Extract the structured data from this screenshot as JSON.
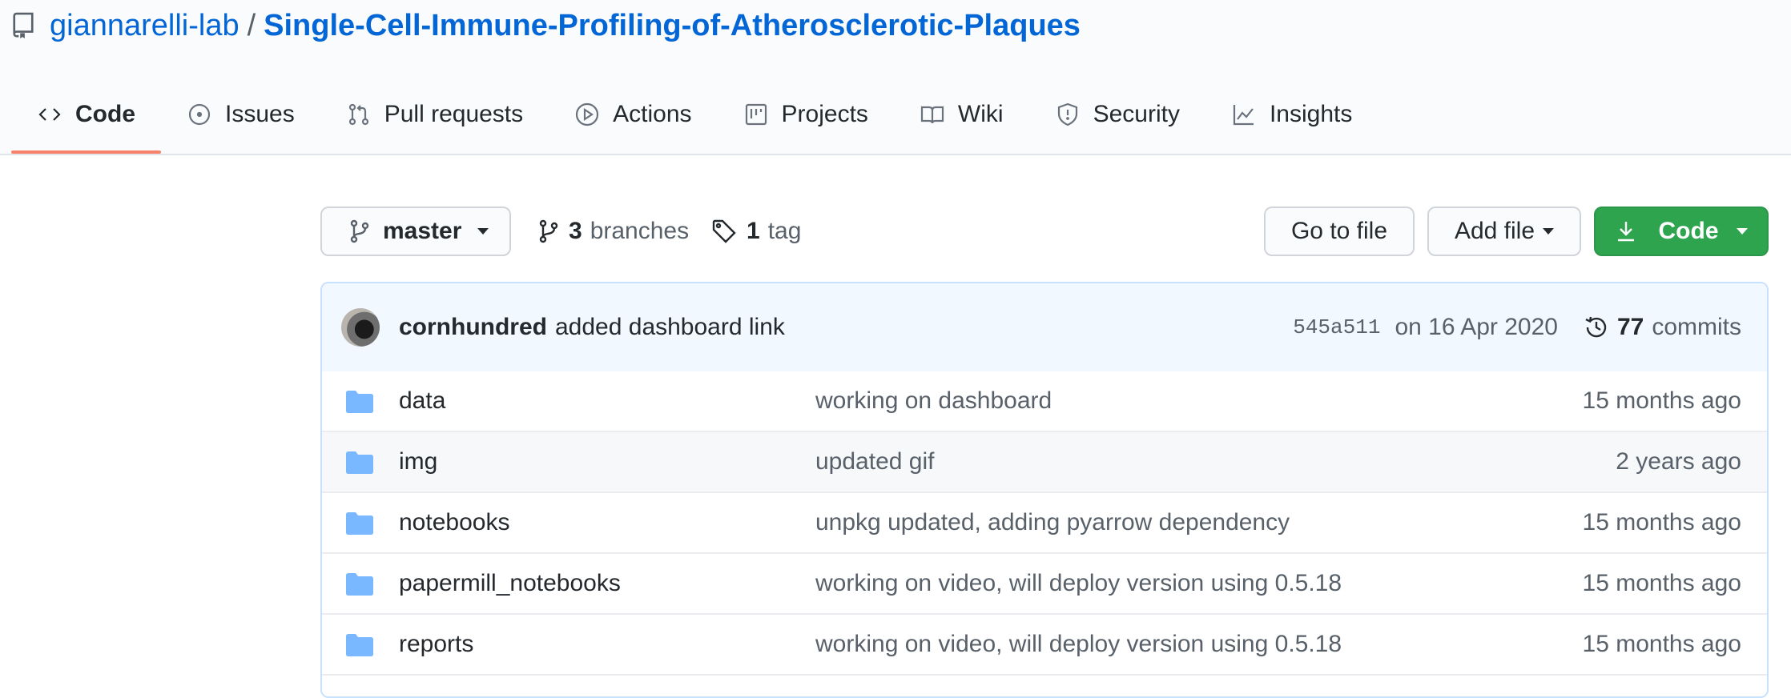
{
  "repo": {
    "owner": "giannarelli-lab",
    "separator": "/",
    "name": "Single-Cell-Immune-Profiling-of-Atherosclerotic-Plaques"
  },
  "tabs": [
    {
      "label": "Code",
      "icon": "code-icon",
      "selected": true
    },
    {
      "label": "Issues",
      "icon": "issue-icon"
    },
    {
      "label": "Pull requests",
      "icon": "pull-request-icon"
    },
    {
      "label": "Actions",
      "icon": "play-icon"
    },
    {
      "label": "Projects",
      "icon": "project-icon"
    },
    {
      "label": "Wiki",
      "icon": "book-icon"
    },
    {
      "label": "Security",
      "icon": "shield-icon"
    },
    {
      "label": "Insights",
      "icon": "graph-icon"
    }
  ],
  "toolbar": {
    "branch": "master",
    "branches_count": "3",
    "branches_label": "branches",
    "tags_count": "1",
    "tags_label": "tag",
    "go_to_file": "Go to file",
    "add_file": "Add file",
    "code": "Code"
  },
  "latest_commit": {
    "author": "cornhundred",
    "message": "added dashboard link",
    "sha": "545a511",
    "date": "on 16 Apr 2020",
    "commits_count": "77",
    "commits_label": "commits"
  },
  "files": [
    {
      "name": "data",
      "message": "working on dashboard",
      "age": "15 months ago"
    },
    {
      "name": "img",
      "message": "updated gif",
      "age": "2 years ago"
    },
    {
      "name": "notebooks",
      "message": "unpkg updated, adding pyarrow dependency",
      "age": "15 months ago"
    },
    {
      "name": "papermill_notebooks",
      "message": "working on video, will deploy version using 0.5.18",
      "age": "15 months ago"
    },
    {
      "name": "reports",
      "message": "working on video, will deploy version using 0.5.18",
      "age": "15 months ago"
    }
  ],
  "colors": {
    "link": "#0366d6",
    "selected_tab_underline": "#f9826c",
    "code_button": "#2ea44f",
    "folder": "#79b8ff",
    "commit_bar": "#f1f8ff"
  }
}
